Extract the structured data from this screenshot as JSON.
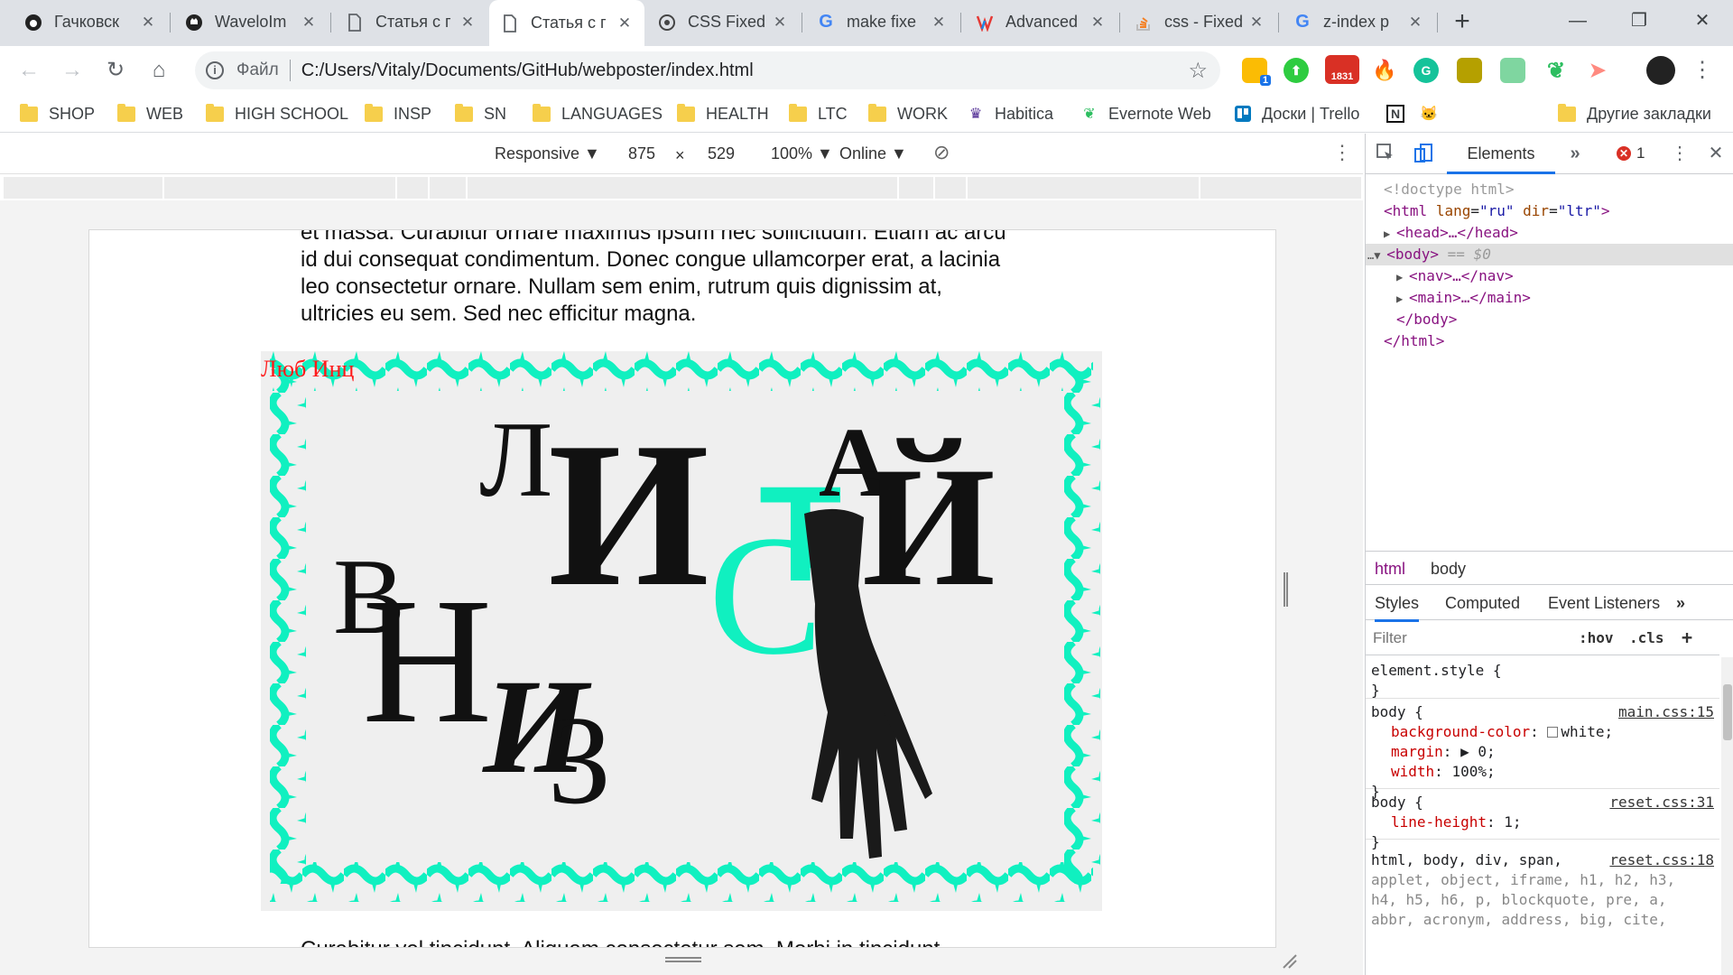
{
  "tabs": [
    {
      "title": "Гачковск",
      "icon": "github-circle-icon"
    },
    {
      "title": "WaveloIm",
      "icon": "github-icon"
    },
    {
      "title": "Статья с г",
      "icon": "page-icon"
    },
    {
      "title": "Статья с г",
      "icon": "page-icon",
      "active": true
    },
    {
      "title": "CSS Fixed",
      "icon": "cssfixed-icon"
    },
    {
      "title": "make fixe",
      "icon": "google-icon"
    },
    {
      "title": "Advanced",
      "icon": "advanced-icon"
    },
    {
      "title": "css - Fixed",
      "icon": "stackoverflow-icon"
    },
    {
      "title": "z-index p",
      "icon": "google-icon"
    }
  ],
  "toolbar": {
    "scheme": "Файл",
    "url": "C:/Users/Vitaly/Documents/GitHub/webposter/index.html",
    "gmail_count": "1831",
    "ext_badge": "1"
  },
  "bookmarks": [
    {
      "label": "SHOP",
      "type": "folder"
    },
    {
      "label": "WEB",
      "type": "folder"
    },
    {
      "label": "HIGH SCHOOL",
      "type": "folder"
    },
    {
      "label": "INSP",
      "type": "folder"
    },
    {
      "label": "SN",
      "type": "folder"
    },
    {
      "label": "LANGUAGES",
      "type": "folder"
    },
    {
      "label": "HEALTH",
      "type": "folder"
    },
    {
      "label": "LTC",
      "type": "folder"
    },
    {
      "label": "WORK",
      "type": "folder"
    },
    {
      "label": "Habitica",
      "type": "link"
    },
    {
      "label": "Evernote Web",
      "type": "link"
    },
    {
      "label": "Доски | Trello",
      "type": "link"
    },
    {
      "label": "",
      "type": "notion"
    },
    {
      "label": "",
      "type": "cat"
    },
    {
      "label": "Другие закладки",
      "type": "folder"
    }
  ],
  "device_toolbar": {
    "mode": "Responsive ▼",
    "width": "875",
    "times": "×",
    "height": "529",
    "zoom": "100% ▼",
    "network": "Online ▼"
  },
  "page": {
    "text_lines": [
      "et massa. Curabitur ornare maximus ipsum nec sollicitudin. Etiam ac arcu",
      "id dui consequat condimentum. Donec congue ullamcorper erat, a lacinia",
      "leo consectetur ornare. Nullam sem enim, rutrum quis dignissim at,",
      "ultricies eu sem. Sed nec efficitur magna."
    ],
    "bottom_text": "Curabitur vel tincidunt. Aliquam consectetur sem. Morbi in tincidunt",
    "poster": {
      "corner_label": "Люб Инц",
      "word_top": "ЛИСТАЙ",
      "word_bottom": "вНИз",
      "glyphs": {
        "l": "Л",
        "i1": "И",
        "s": "С",
        "t": "Т",
        "a": "А",
        "y": "Й",
        "v": "В",
        "n": "Н",
        "i2": "И",
        "z": "З"
      },
      "accent_color": "#10f0c0"
    }
  },
  "devtools": {
    "elements_tab": "Elements",
    "more_tabs": "»",
    "error_count": "1",
    "dom": [
      {
        "open": "<!doctype html>"
      },
      {
        "open": "<html",
        "attr": "lang",
        "val": "\"ru\"",
        "attr2": "dir",
        "val2": "\"ltr\"",
        "close": ">"
      },
      {
        "tri": "▶",
        "open": "<head>…</head>"
      },
      {
        "tri": "▼",
        "open": "<body>",
        "extra": " == $0"
      },
      {
        "tri": "▶",
        "open": "<nav>…</nav>"
      },
      {
        "tri": "▶",
        "open": "<main>…</main>"
      },
      {
        "open": "</body>"
      },
      {
        "open": "</html>"
      }
    ],
    "breadcrumbs": [
      "html",
      "body"
    ],
    "subtabs": [
      "Styles",
      "Computed",
      "Event Listeners",
      "»"
    ],
    "filter_placeholder": "Filter",
    "hov": ":hov",
    "cls": ".cls",
    "plus": "+",
    "rules": [
      {
        "selector": "element.style {",
        "source": "",
        "props": [],
        "close": "}"
      },
      {
        "selector": "body {",
        "source": "main.css:15",
        "props": [
          {
            "name": "background-color",
            "value": "white;",
            "swatch": "#ffffff"
          },
          {
            "name": "margin",
            "value": "▶ 0;"
          },
          {
            "name": "width",
            "value": "100%;"
          }
        ],
        "close": "}"
      },
      {
        "selector": "body {",
        "source": "reset.css:31",
        "props": [
          {
            "name": "line-height",
            "value": "1;"
          }
        ],
        "close": "}"
      },
      {
        "selector": "html, body, div, span,",
        "source": "reset.css:18",
        "lines": [
          "applet, object, iframe, h1, h2, h3,",
          "h4, h5, h6, p, blockquote, pre, a,",
          "abbr, acronym, address, big, cite,"
        ],
        "props": [],
        "close": ""
      }
    ]
  }
}
